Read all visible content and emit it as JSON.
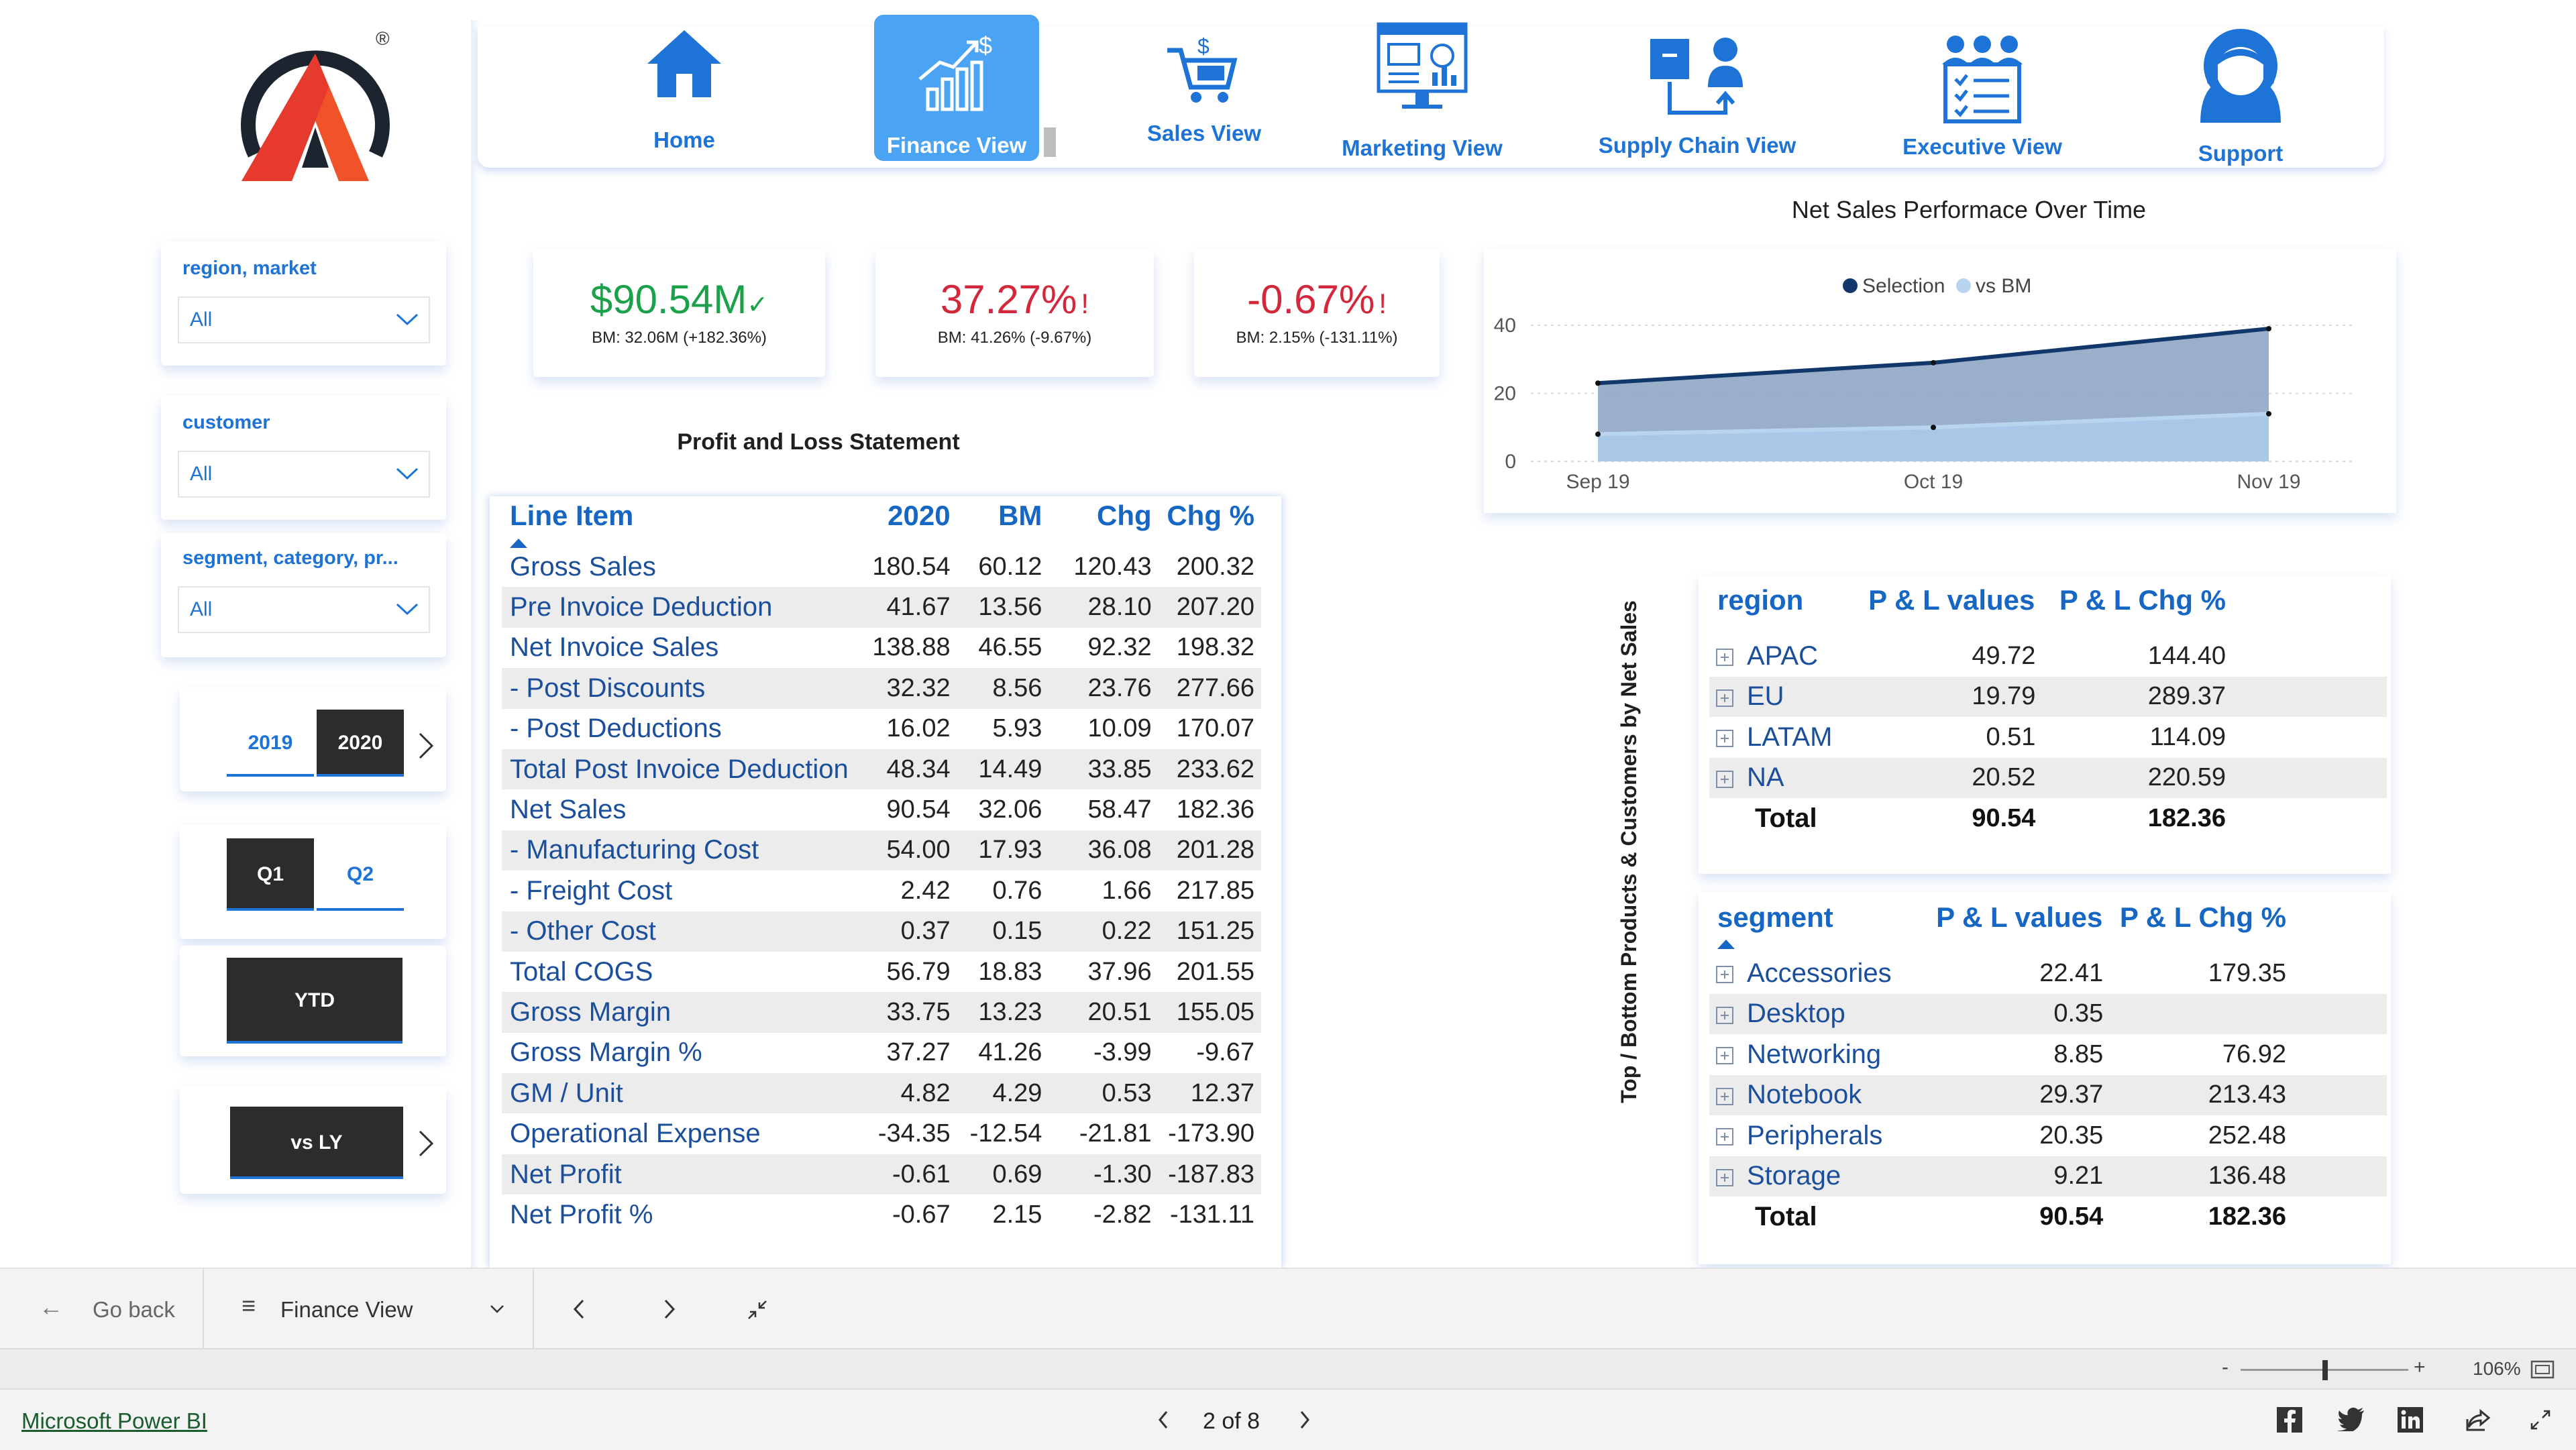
{
  "nav": {
    "home": "Home",
    "finance": "Finance View",
    "sales": "Sales View",
    "marketing": "Marketing View",
    "supply": "Supply Chain View",
    "executive": "Executive View",
    "support": "Support"
  },
  "logo": {
    "registered": "®"
  },
  "filters": {
    "region_title": "region, market",
    "region_value": "All",
    "customer_title": "customer",
    "customer_value": "All",
    "segment_title": "segment, category, pr...",
    "segment_value": "All"
  },
  "years": {
    "y2019": "2019",
    "y2020": "2020",
    "selected": "2020"
  },
  "quarters": {
    "q1": "Q1",
    "q2": "Q2",
    "selected": "Q1"
  },
  "ytd": {
    "label": "YTD"
  },
  "comparison": {
    "label": "vs LY"
  },
  "kpis": [
    {
      "value": "$90.54M",
      "indicator": "✓",
      "bm": "BM: 32.06M (+182.36%)",
      "color": "#1aa14a"
    },
    {
      "value": "37.27%",
      "indicator": "!",
      "bm": "BM: 41.26% (-9.67%)",
      "color": "#d3283b"
    },
    {
      "value": "-0.67%",
      "indicator": "!",
      "bm": "BM: 2.15% (-131.11%)",
      "color": "#d3283b"
    }
  ],
  "pl": {
    "title": "Profit and Loss Statement",
    "headers": [
      "Line Item",
      "2020",
      "BM",
      "Chg",
      "Chg %"
    ],
    "rows": [
      [
        "Gross Sales",
        "180.54",
        "60.12",
        "120.43",
        "200.32"
      ],
      [
        "Pre Invoice Deduction",
        "41.67",
        "13.56",
        "28.10",
        "207.20"
      ],
      [
        "Net Invoice Sales",
        "138.88",
        "46.55",
        "92.32",
        "198.32"
      ],
      [
        "- Post Discounts",
        "32.32",
        "8.56",
        "23.76",
        "277.66"
      ],
      [
        "- Post Deductions",
        "16.02",
        "5.93",
        "10.09",
        "170.07"
      ],
      [
        "Total Post Invoice Deduction",
        "48.34",
        "14.49",
        "33.85",
        "233.62"
      ],
      [
        "Net Sales",
        "90.54",
        "32.06",
        "58.47",
        "182.36"
      ],
      [
        "- Manufacturing Cost",
        "54.00",
        "17.93",
        "36.08",
        "201.28"
      ],
      [
        "- Freight Cost",
        "2.42",
        "0.76",
        "1.66",
        "217.85"
      ],
      [
        "- Other Cost",
        "0.37",
        "0.15",
        "0.22",
        "151.25"
      ],
      [
        "Total COGS",
        "56.79",
        "18.83",
        "37.96",
        "201.55"
      ],
      [
        "Gross Margin",
        "33.75",
        "13.23",
        "20.51",
        "155.05"
      ],
      [
        "Gross Margin %",
        "37.27",
        "41.26",
        "-3.99",
        "-9.67"
      ],
      [
        "GM / Unit",
        "4.82",
        "4.29",
        "0.53",
        "12.37"
      ],
      [
        "Operational Expense",
        "-34.35",
        "-12.54",
        "-21.81",
        "-173.90"
      ],
      [
        "Net Profit",
        "-0.61",
        "0.69",
        "-1.30",
        "-187.83"
      ],
      [
        "Net Profit %",
        "-0.67",
        "2.15",
        "-2.82",
        "-131.11"
      ]
    ]
  },
  "chart_data": {
    "type": "area",
    "title": "Net Sales Performace Over Time",
    "categories": [
      "Sep 19",
      "Oct 19",
      "Nov 19"
    ],
    "series": [
      {
        "name": "Selection",
        "values": [
          23,
          29,
          39
        ],
        "color": "#12386b"
      },
      {
        "name": "vs BM",
        "values": [
          8,
          10,
          14
        ],
        "color": "#b9d4ef"
      }
    ],
    "ylim": [
      0,
      40
    ],
    "yticks": [
      "0",
      "20",
      "40"
    ],
    "legend": "top-center"
  },
  "side_title": "Top / Bottom Products & Customers by Net Sales",
  "region_table": {
    "headers": [
      "region",
      "P & L values",
      "P & L Chg %"
    ],
    "rows": [
      [
        "APAC",
        "49.72",
        "144.40"
      ],
      [
        "EU",
        "19.79",
        "289.37"
      ],
      [
        "LATAM",
        "0.51",
        "114.09"
      ],
      [
        "NA",
        "20.52",
        "220.59"
      ]
    ],
    "total": [
      "Total",
      "90.54",
      "182.36"
    ]
  },
  "segment_table": {
    "headers": [
      "segment",
      "P & L values",
      "P & L Chg %"
    ],
    "rows": [
      [
        "Accessories",
        "22.41",
        "179.35"
      ],
      [
        "Desktop",
        "0.35",
        ""
      ],
      [
        "Networking",
        "8.85",
        "76.92"
      ],
      [
        "Notebook",
        "29.37",
        "213.43"
      ],
      [
        "Peripherals",
        "20.35",
        "252.48"
      ],
      [
        "Storage",
        "9.21",
        "136.48"
      ]
    ],
    "total": [
      "Total",
      "90.54",
      "182.36"
    ]
  },
  "bottom_nav": {
    "go_back": "Go back",
    "page_select": "Finance View"
  },
  "status": {
    "zoom": "106%",
    "minus": "-",
    "plus": "+"
  },
  "footer": {
    "brand": "Microsoft Power BI",
    "pages": "2 of 8"
  }
}
